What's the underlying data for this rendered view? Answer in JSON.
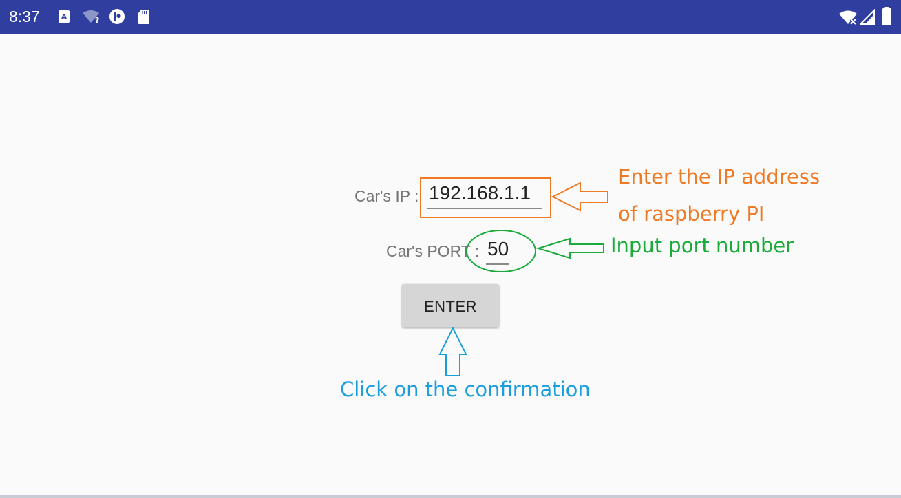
{
  "status_bar": {
    "time": "8:37",
    "left_icons": [
      "app-a-icon",
      "wifi-question-icon",
      "circle-app-icon",
      "sd-card-icon"
    ],
    "right_icons": [
      "wifi-off-icon",
      "signal-icon",
      "battery-icon"
    ],
    "background": "#303f9f"
  },
  "form": {
    "ip_label": "Car's IP :",
    "ip_value": "192.168.1.1",
    "port_label": "Car's PORT :",
    "port_value": "50",
    "enter_label": "ENTER"
  },
  "annotations": {
    "ip_hint_line1": "Enter the IP address",
    "ip_hint_line2": "of raspberry PI",
    "port_hint": "Input port number",
    "enter_hint": "Click on the confirmation",
    "colors": {
      "ip": "#f07a24",
      "port": "#1aab3a",
      "enter": "#1a9ee0"
    }
  }
}
